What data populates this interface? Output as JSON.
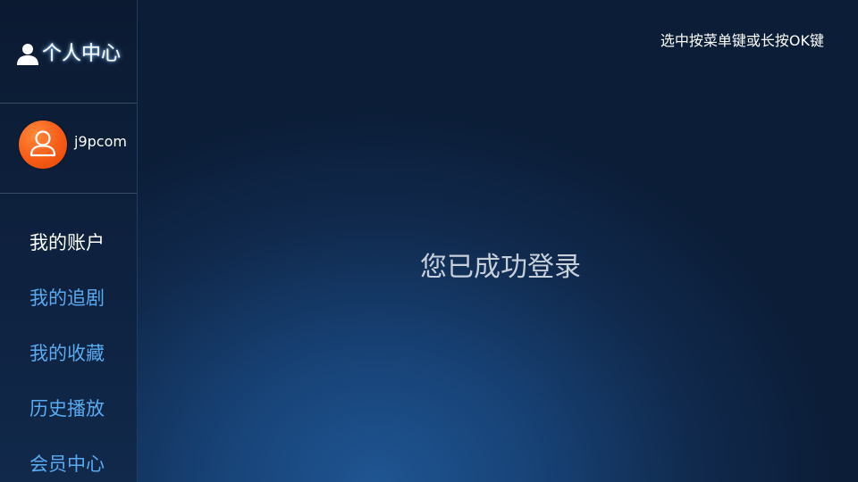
{
  "header": {
    "title": "个人中心",
    "icon": "person-icon"
  },
  "user": {
    "name": "j9pcom",
    "avatar_icon": "user-avatar-icon",
    "avatar_color": "#f75b16"
  },
  "menu": {
    "items": [
      {
        "label": "我的账户",
        "active": true
      },
      {
        "label": "我的追剧",
        "active": false
      },
      {
        "label": "我的收藏",
        "active": false
      },
      {
        "label": "历史播放",
        "active": false
      },
      {
        "label": "会员中心",
        "active": false
      }
    ]
  },
  "hint": "选中按菜单键或长按OK键",
  "main": {
    "message": "您已成功登录"
  },
  "colors": {
    "accent": "#5aaaf0",
    "active_text": "#ffffff",
    "background": "#174276"
  }
}
